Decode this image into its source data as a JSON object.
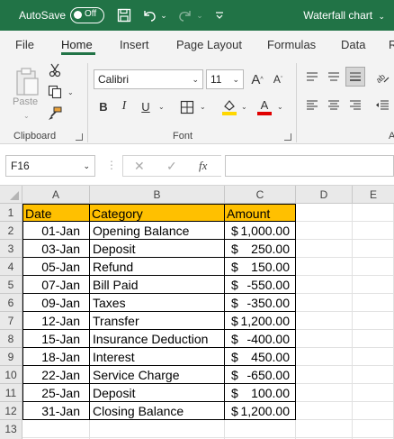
{
  "titlebar": {
    "autosave_label": "AutoSave",
    "toggle_state": "Off",
    "document_title": "Waterfall chart",
    "bg_color": "#217346"
  },
  "ribbon_tabs": [
    "File",
    "Home",
    "Insert",
    "Page Layout",
    "Formulas",
    "Data",
    "R"
  ],
  "active_tab": "Home",
  "clipboard": {
    "paste_label": "Paste",
    "group_label": "Clipboard"
  },
  "font": {
    "family": "Calibri",
    "size": "11",
    "grow_label": "A",
    "shrink_label": "A",
    "bold": "B",
    "italic": "I",
    "underline": "U",
    "color_letter": "A",
    "group_label": "Font",
    "highlight_color": "#ffd700",
    "font_color": "#e00000"
  },
  "alignment": {
    "group_label": "A"
  },
  "formula_bar": {
    "name_box": "F16",
    "cancel_symbol": "✕",
    "enter_symbol": "✓",
    "fx_label": "fx",
    "formula": ""
  },
  "columns": [
    "A",
    "B",
    "C",
    "D",
    "E"
  ],
  "rows": [
    "1",
    "2",
    "3",
    "4",
    "5",
    "6",
    "7",
    "8",
    "9",
    "10",
    "11",
    "12",
    "13"
  ],
  "table": {
    "header_color": "#ffc000",
    "headers": [
      "Date",
      "Category",
      "Amount"
    ],
    "rows": [
      {
        "date": "01-Jan",
        "category": "Opening Balance",
        "currency": "$",
        "amount": "1,000.00"
      },
      {
        "date": "03-Jan",
        "category": "Deposit",
        "currency": "$",
        "amount": "250.00"
      },
      {
        "date": "05-Jan",
        "category": "Refund",
        "currency": "$",
        "amount": "150.00"
      },
      {
        "date": "07-Jan",
        "category": "Bill Paid",
        "currency": "$",
        "amount": "-550.00"
      },
      {
        "date": "09-Jan",
        "category": "Taxes",
        "currency": "$",
        "amount": "-350.00"
      },
      {
        "date": "12-Jan",
        "category": "Transfer",
        "currency": "$",
        "amount": "1,200.00"
      },
      {
        "date": "15-Jan",
        "category": "Insurance Deduction",
        "currency": "$",
        "amount": "-400.00"
      },
      {
        "date": "18-Jan",
        "category": "Interest",
        "currency": "$",
        "amount": "450.00"
      },
      {
        "date": "22-Jan",
        "category": "Service Charge",
        "currency": "$",
        "amount": "-650.00"
      },
      {
        "date": "25-Jan",
        "category": "Deposit",
        "currency": "$",
        "amount": "100.00"
      },
      {
        "date": "31-Jan",
        "category": "Closing Balance",
        "currency": "$",
        "amount": "1,200.00"
      }
    ]
  }
}
